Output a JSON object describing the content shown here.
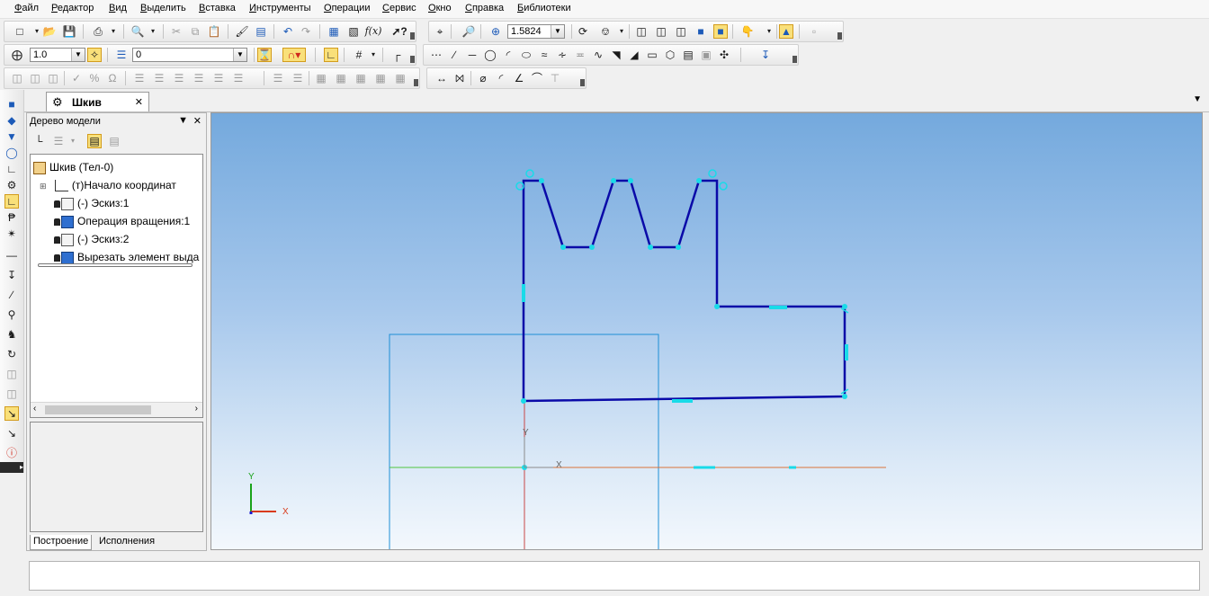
{
  "menu": [
    "Файл",
    "Редактор",
    "Вид",
    "Выделить",
    "Вставка",
    "Инструменты",
    "Операции",
    "Сервис",
    "Окно",
    "Справка",
    "Библиотеки"
  ],
  "toolbar": {
    "zoom_value": "1.5824",
    "line_scale_value": "1.0",
    "layer_value": "0"
  },
  "document_tab": {
    "title": "Шкив",
    "close": "✕"
  },
  "model_tree": {
    "title": "Дерево модели",
    "pin_icon": "pin-icon",
    "close": "✕",
    "root": "Шкив (Тел-0)",
    "items": [
      {
        "label": "(т)Начало координат",
        "locked": false
      },
      {
        "label": "(-) Эскиз:1",
        "locked": true
      },
      {
        "label": "Операция вращения:1",
        "locked": true
      },
      {
        "label": "(-) Эскиз:2",
        "locked": true
      },
      {
        "label": "Вырезать элемент выда",
        "locked": true
      }
    ],
    "tabs": [
      "Построение",
      "Исполнения"
    ]
  },
  "canvas": {
    "axis_y": "Y",
    "axis_x": "X",
    "colors": {
      "sketch": "#0a0aa8",
      "point": "#19dbe8",
      "axis_x": "#d93a1a",
      "axis_y": "#1aa31a",
      "frame": "#1e8fd6"
    }
  }
}
